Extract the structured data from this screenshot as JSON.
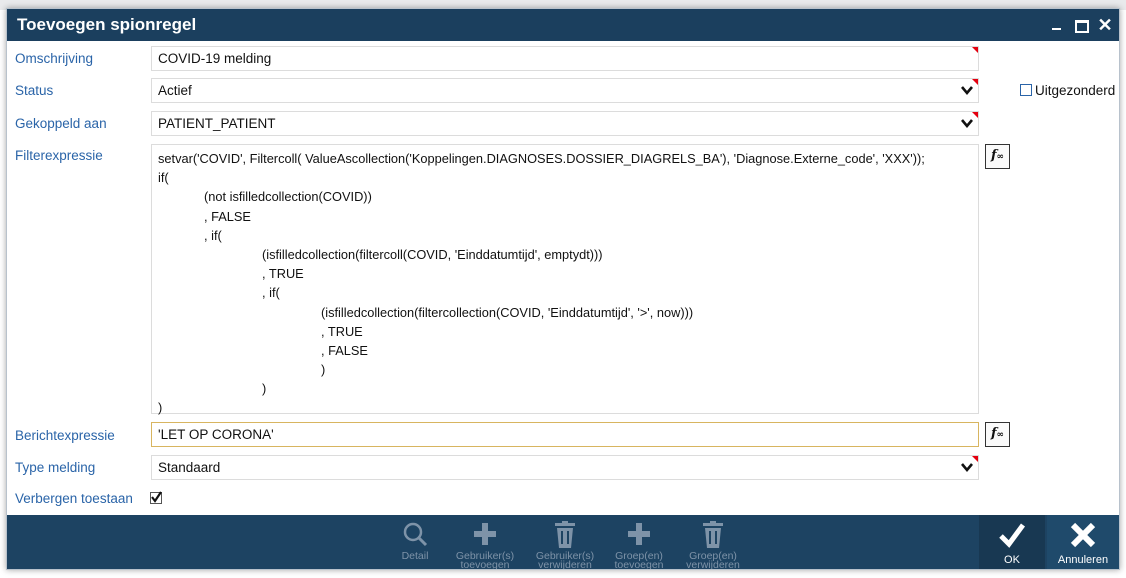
{
  "window": {
    "title": "Toevoegen spionregel"
  },
  "form": {
    "omschrijving": {
      "label": "Omschrijving",
      "value": "COVID-19 melding"
    },
    "status": {
      "label": "Status",
      "value": "Actief",
      "exempt_label": "Uitgezonderd"
    },
    "gekoppeld": {
      "label": "Gekoppeld aan",
      "value": "PATIENT_PATIENT"
    },
    "filter": {
      "label": "Filterexpressie",
      "lines": [
        "setvar('COVID', Filtercoll( ValueAscollection('Koppelingen.DIAGNOSES.DOSSIER_DIAGRELS_BA'), 'Diagnose.Externe_code', 'XXX'));",
        "if(",
        "(not isfilledcollection(COVID))",
        ", FALSE",
        ", if(",
        "(isfilledcollection(filtercoll(COVID, 'Einddatumtijd', emptydt)))",
        ", TRUE",
        ", if(",
        "(isfilledcollection(filtercollection(COVID, 'Einddatumtijd', '>', now)))",
        ", TRUE",
        ", FALSE",
        ")",
        ")",
        ")"
      ]
    },
    "bericht": {
      "label": "Berichtexpressie",
      "value": "'LET OP CORONA'"
    },
    "type": {
      "label": "Type melding",
      "value": "Standaard"
    },
    "verbergen": {
      "label": "Verbergen toestaan",
      "checked": true
    }
  },
  "footer": {
    "buttons": [
      {
        "name": "detail-button",
        "icon": "magnifier-icon",
        "label1": "Detail",
        "label2": ""
      },
      {
        "name": "add-users-button",
        "icon": "plus-icon",
        "label1": "Gebruiker(s)",
        "label2": "toevoegen"
      },
      {
        "name": "remove-users-button",
        "icon": "trash-icon",
        "label1": "Gebruiker(s)",
        "label2": "verwijderen"
      },
      {
        "name": "add-groups-button",
        "icon": "plus-icon",
        "label1": "Groep(en)",
        "label2": "toevoegen"
      },
      {
        "name": "remove-groups-button",
        "icon": "trash-icon",
        "label1": "Groep(en)",
        "label2": "verwijderen"
      }
    ],
    "ok_label": "OK",
    "cancel_label": "Annuleren"
  },
  "colors": {
    "titlebar": "#1b3f5e",
    "footer": "#1d4362",
    "label": "#2a64a8",
    "required_marker": "#e4000f"
  }
}
